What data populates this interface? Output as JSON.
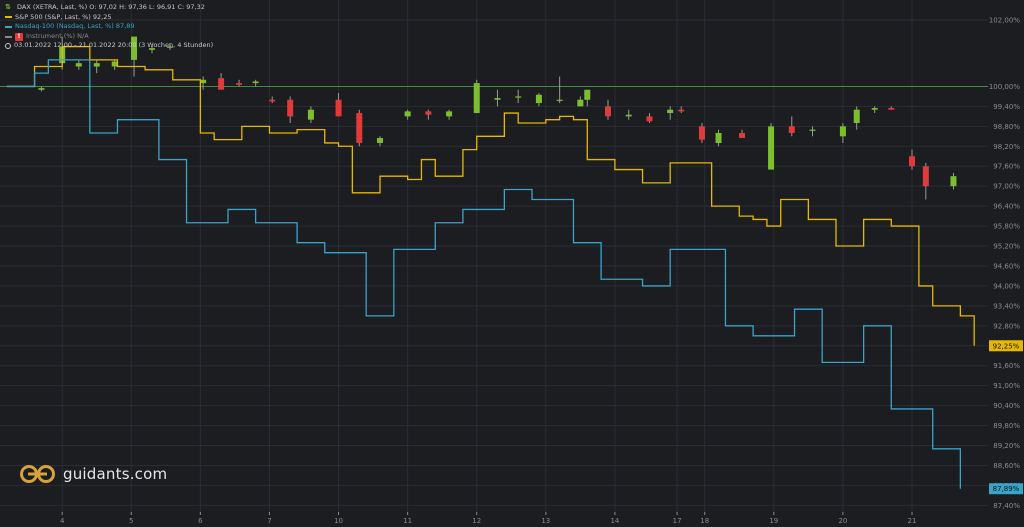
{
  "legend": {
    "dax": "DAX (XETRA, Last, %)  O: 97,02  H: 97,36  L: 96,91  C: 97,32",
    "sp500": "S&P 500 (S&P, Last, %)  92,25",
    "nasdaq": "Nasdaq-100 (Nasdaq, Last, %)  87,89",
    "instrument": "Instrument (%)  N/A",
    "range": "03.01.2022 12:00 - 21.01.2022 20:00  (3 Wochen, 4 Stunden)"
  },
  "logo": {
    "text": "guidants.com"
  },
  "colors": {
    "background": "#1b1d21",
    "grid": "#2a2d33",
    "baseline": "#3f8c3f",
    "up": "#7bbf2f",
    "down": "#e03a3a",
    "sp500": "#e6b800",
    "nasdaq": "#3aa3c8",
    "axis_text": "#8c8c8c"
  },
  "chart_data": {
    "type": "line",
    "title": "",
    "x_label": "",
    "y_label": "",
    "y_unit": "%",
    "ylim": [
      87.2,
      102.6
    ],
    "y_ticks": [
      87.4,
      88.0,
      88.6,
      89.2,
      89.8,
      90.4,
      91.0,
      91.6,
      92.2,
      92.8,
      93.4,
      94.0,
      94.6,
      95.2,
      95.8,
      96.4,
      97.0,
      97.6,
      98.2,
      98.8,
      99.4,
      100.0,
      102.0
    ],
    "y_tick_labels": [
      "87,40%",
      "88,00%",
      "88,60%",
      "89,20%",
      "89,80%",
      "90,40%",
      "91,00%",
      "91,60%",
      "92,20%",
      "92,80%",
      "93,40%",
      "94,00%",
      "94,60%",
      "95,20%",
      "95,80%",
      "96,40%",
      "97,00%",
      "97,60%",
      "98,20%",
      "98,80%",
      "99,40%",
      "100,00%",
      "102,00%"
    ],
    "x_ticks": [
      {
        "x": 4,
        "label": "4"
      },
      {
        "x": 9,
        "label": "5"
      },
      {
        "x": 14,
        "label": "6"
      },
      {
        "x": 19,
        "label": "7"
      },
      {
        "x": 24,
        "label": "10"
      },
      {
        "x": 29,
        "label": "11"
      },
      {
        "x": 34,
        "label": "12"
      },
      {
        "x": 39,
        "label": "13"
      },
      {
        "x": 44,
        "label": "14"
      },
      {
        "x": 48.5,
        "label": "17"
      },
      {
        "x": 50.5,
        "label": "18"
      },
      {
        "x": 55.5,
        "label": "19"
      },
      {
        "x": 60.5,
        "label": "20"
      },
      {
        "x": 65.5,
        "label": "21"
      }
    ],
    "x_range": [
      -0.5,
      71
    ],
    "baseline": 100,
    "grid": true,
    "series": [
      {
        "name": "S&P 500",
        "kind": "step-line",
        "last_label": "92,25%",
        "values": [
          100.0,
          100.0,
          100.6,
          100.6,
          101.2,
          101.2,
          100.8,
          100.8,
          100.6,
          100.6,
          100.5,
          100.5,
          100.2,
          100.2,
          98.6,
          98.4,
          98.4,
          98.8,
          98.8,
          98.6,
          98.6,
          98.7,
          98.7,
          98.3,
          98.2,
          96.8,
          96.8,
          97.3,
          97.3,
          97.2,
          97.8,
          97.3,
          97.3,
          98.1,
          98.5,
          98.5,
          99.2,
          98.9,
          98.9,
          99.0,
          99.1,
          99.0,
          97.8,
          97.8,
          97.5,
          97.5,
          97.1,
          97.1,
          97.7,
          97.7,
          97.7,
          96.4,
          96.4,
          96.1,
          96.0,
          95.8,
          96.6,
          96.6,
          96.0,
          96.0,
          95.2,
          95.2,
          96.0,
          96.0,
          95.8,
          95.8,
          94.0,
          93.4,
          93.4,
          93.1,
          92.2
        ]
      },
      {
        "name": "Nasdaq-100",
        "kind": "step-line",
        "last_label": "87,89%",
        "values": [
          100.0,
          100.0,
          100.4,
          100.8,
          100.8,
          100.8,
          98.6,
          98.6,
          99.0,
          99.0,
          99.0,
          97.8,
          97.8,
          95.9,
          95.9,
          95.9,
          96.3,
          96.3,
          95.9,
          95.9,
          95.9,
          95.3,
          95.3,
          95.0,
          95.0,
          95.0,
          93.1,
          93.1,
          95.1,
          95.1,
          95.1,
          95.9,
          95.9,
          96.3,
          96.3,
          96.3,
          96.9,
          96.9,
          96.6,
          96.6,
          96.6,
          95.3,
          95.3,
          94.2,
          94.2,
          94.2,
          94.0,
          94.0,
          95.1,
          95.1,
          95.1,
          95.1,
          92.8,
          92.8,
          92.5,
          92.5,
          92.5,
          93.3,
          93.3,
          91.7,
          91.7,
          91.7,
          92.8,
          92.8,
          90.3,
          90.3,
          90.3,
          89.1,
          89.1,
          87.9
        ]
      },
      {
        "name": "DAX",
        "kind": "candlestick",
        "candles": [
          {
            "x": 2.5,
            "o": 99.9,
            "h": 100.0,
            "l": 99.85,
            "c": 99.95
          },
          {
            "x": 4.0,
            "o": 100.7,
            "h": 101.5,
            "l": 100.5,
            "c": 101.2
          },
          {
            "x": 5.2,
            "o": 100.6,
            "h": 100.8,
            "l": 100.5,
            "c": 100.7
          },
          {
            "x": 6.5,
            "o": 100.6,
            "h": 100.8,
            "l": 100.4,
            "c": 100.7
          },
          {
            "x": 7.8,
            "o": 100.6,
            "h": 100.8,
            "l": 100.5,
            "c": 100.75
          },
          {
            "x": 9.2,
            "o": 100.8,
            "h": 101.0,
            "l": 100.3,
            "c": 101.5
          },
          {
            "x": 10.5,
            "o": 101.1,
            "h": 101.2,
            "l": 101.0,
            "c": 101.15
          },
          {
            "x": 11.8,
            "o": 101.2,
            "h": 101.3,
            "l": 101.1,
            "c": 101.2
          },
          {
            "x": 14.2,
            "o": 100.1,
            "h": 100.3,
            "l": 99.9,
            "c": 100.2
          },
          {
            "x": 15.5,
            "o": 100.25,
            "h": 100.4,
            "l": 100.0,
            "c": 99.9
          },
          {
            "x": 16.8,
            "o": 100.1,
            "h": 100.2,
            "l": 100.0,
            "c": 100.05
          },
          {
            "x": 18.0,
            "o": 100.1,
            "h": 100.2,
            "l": 100.0,
            "c": 100.15
          },
          {
            "x": 19.2,
            "o": 99.6,
            "h": 99.7,
            "l": 99.5,
            "c": 99.55
          },
          {
            "x": 20.5,
            "o": 99.6,
            "h": 99.7,
            "l": 98.9,
            "c": 99.1
          },
          {
            "x": 22.0,
            "o": 99.0,
            "h": 99.4,
            "l": 98.9,
            "c": 99.3
          },
          {
            "x": 24.0,
            "o": 99.6,
            "h": 99.8,
            "l": 99.1,
            "c": 99.1
          },
          {
            "x": 25.5,
            "o": 99.2,
            "h": 99.3,
            "l": 98.2,
            "c": 98.3
          },
          {
            "x": 27.0,
            "o": 98.3,
            "h": 98.5,
            "l": 98.2,
            "c": 98.45
          },
          {
            "x": 29.0,
            "o": 99.1,
            "h": 99.3,
            "l": 99.0,
            "c": 99.25
          },
          {
            "x": 30.5,
            "o": 99.25,
            "h": 99.3,
            "l": 99.0,
            "c": 99.15
          },
          {
            "x": 32.0,
            "o": 99.1,
            "h": 99.3,
            "l": 99.0,
            "c": 99.25
          },
          {
            "x": 34.0,
            "o": 99.2,
            "h": 100.2,
            "l": 99.2,
            "c": 100.1
          },
          {
            "x": 35.5,
            "o": 99.6,
            "h": 99.9,
            "l": 99.4,
            "c": 99.65
          },
          {
            "x": 37.0,
            "o": 99.7,
            "h": 99.9,
            "l": 99.5,
            "c": 99.7
          },
          {
            "x": 38.5,
            "o": 99.5,
            "h": 99.8,
            "l": 99.4,
            "c": 99.75
          },
          {
            "x": 40.0,
            "o": 99.6,
            "h": 100.3,
            "l": 99.5,
            "c": 99.6
          },
          {
            "x": 41.5,
            "o": 99.4,
            "h": 99.7,
            "l": 99.4,
            "c": 99.6
          },
          {
            "x": 42.0,
            "o": 99.6,
            "h": 99.8,
            "l": 99.4,
            "c": 99.9
          },
          {
            "x": 43.5,
            "o": 99.4,
            "h": 99.6,
            "l": 99.0,
            "c": 99.1
          },
          {
            "x": 45.0,
            "o": 99.1,
            "h": 99.3,
            "l": 99.0,
            "c": 99.15
          },
          {
            "x": 46.5,
            "o": 99.1,
            "h": 99.2,
            "l": 98.9,
            "c": 98.95
          },
          {
            "x": 48.0,
            "o": 99.2,
            "h": 99.4,
            "l": 99.0,
            "c": 99.3
          },
          {
            "x": 48.8,
            "o": 99.3,
            "h": 99.4,
            "l": 99.2,
            "c": 99.25
          },
          {
            "x": 50.3,
            "o": 98.8,
            "h": 98.9,
            "l": 98.3,
            "c": 98.4
          },
          {
            "x": 51.5,
            "o": 98.3,
            "h": 98.7,
            "l": 98.2,
            "c": 98.6
          },
          {
            "x": 53.2,
            "o": 98.6,
            "h": 98.7,
            "l": 98.5,
            "c": 98.45
          },
          {
            "x": 55.3,
            "o": 97.5,
            "h": 98.9,
            "l": 97.5,
            "c": 98.8
          },
          {
            "x": 56.8,
            "o": 98.8,
            "h": 99.1,
            "l": 98.5,
            "c": 98.6
          },
          {
            "x": 58.3,
            "o": 98.7,
            "h": 98.8,
            "l": 98.5,
            "c": 98.7
          },
          {
            "x": 60.5,
            "o": 98.5,
            "h": 98.9,
            "l": 98.3,
            "c": 98.8
          },
          {
            "x": 61.5,
            "o": 98.9,
            "h": 99.4,
            "l": 98.7,
            "c": 99.3
          },
          {
            "x": 62.8,
            "o": 99.3,
            "h": 99.4,
            "l": 99.2,
            "c": 99.35
          },
          {
            "x": 64.0,
            "o": 99.35,
            "h": 99.4,
            "l": 99.3,
            "c": 99.3
          },
          {
            "x": 65.5,
            "o": 97.9,
            "h": 98.1,
            "l": 97.5,
            "c": 97.6
          },
          {
            "x": 66.5,
            "o": 97.6,
            "h": 97.7,
            "l": 96.6,
            "c": 97.0
          },
          {
            "x": 68.5,
            "o": 97.0,
            "h": 97.4,
            "l": 96.9,
            "c": 97.3
          }
        ]
      }
    ]
  }
}
